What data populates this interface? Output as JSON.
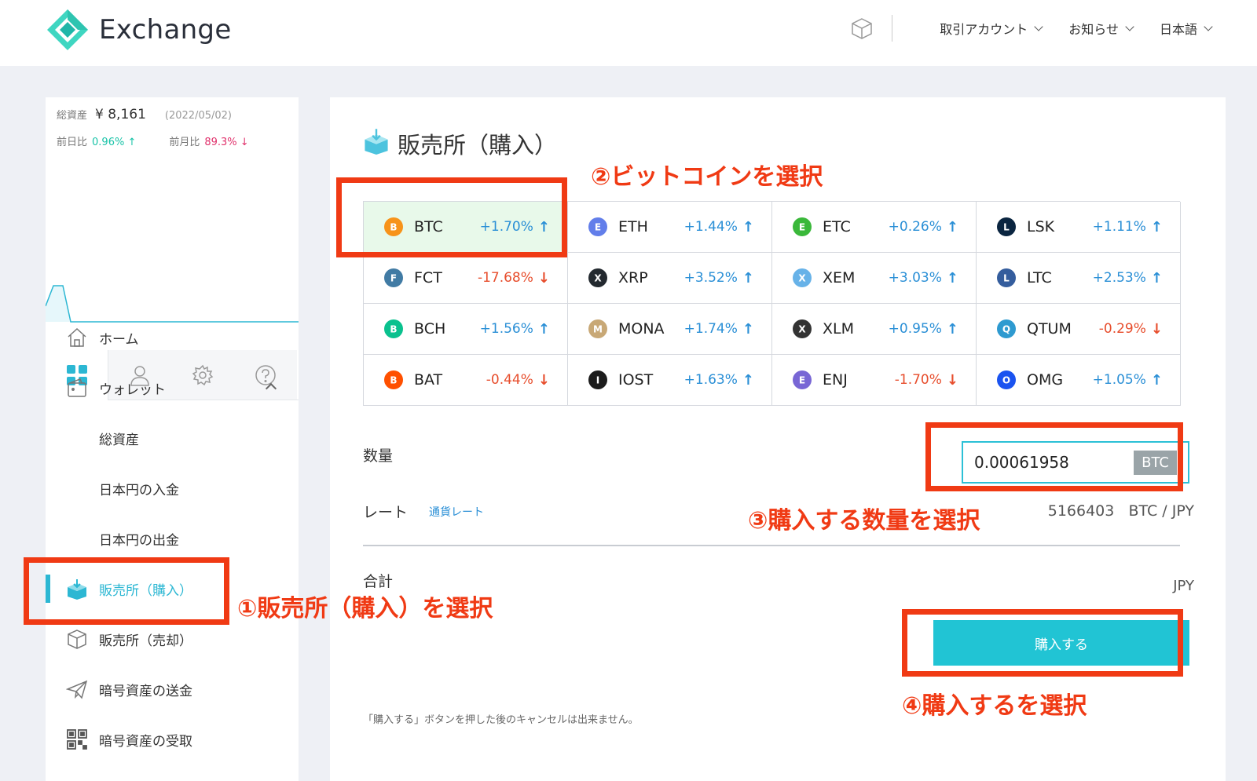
{
  "header": {
    "app_name": "Exchange",
    "menus": [
      "取引アカウント",
      "お知らせ",
      "日本語"
    ]
  },
  "sidebar": {
    "assets": {
      "label": "総資産",
      "value": "¥ 8,161",
      "date": "(2022/05/02)",
      "day_label": "前日比",
      "day_value": "0.96% ↑",
      "month_label": "前月比",
      "month_value": "89.3% ↓"
    },
    "nav": [
      {
        "label": "ホーム",
        "icon": "home-icon"
      },
      {
        "label": "ウォレット",
        "icon": "wallet-icon"
      },
      {
        "label": "総資産",
        "icon": ""
      },
      {
        "label": "日本円の入金",
        "icon": ""
      },
      {
        "label": "日本円の出金",
        "icon": ""
      },
      {
        "label": "販売所（購入）",
        "icon": "buy-box-icon",
        "active": true
      },
      {
        "label": "販売所（売却）",
        "icon": "sell-box-icon"
      },
      {
        "label": "暗号資産の送金",
        "icon": "send-icon"
      },
      {
        "label": "暗号資産の受取",
        "icon": "qr-icon"
      }
    ]
  },
  "main": {
    "title": "販売所（購入）",
    "coins": [
      {
        "symbol": "BTC",
        "change": "+1.70%",
        "dir": "up",
        "color": "#f7931a",
        "selected": true
      },
      {
        "symbol": "ETH",
        "change": "+1.44%",
        "dir": "up",
        "color": "#627eea"
      },
      {
        "symbol": "ETC",
        "change": "+0.26%",
        "dir": "up",
        "color": "#3ab83a"
      },
      {
        "symbol": "LSK",
        "change": "+1.11%",
        "dir": "up",
        "color": "#0a2540"
      },
      {
        "symbol": "FCT",
        "change": "-17.68%",
        "dir": "down",
        "color": "#417ba4"
      },
      {
        "symbol": "XRP",
        "change": "+3.52%",
        "dir": "up",
        "color": "#23292f"
      },
      {
        "symbol": "XEM",
        "change": "+3.03%",
        "dir": "up",
        "color": "#67b2e8"
      },
      {
        "symbol": "LTC",
        "change": "+2.53%",
        "dir": "up",
        "color": "#345d9d"
      },
      {
        "symbol": "BCH",
        "change": "+1.56%",
        "dir": "up",
        "color": "#0ac18e"
      },
      {
        "symbol": "MONA",
        "change": "+1.74%",
        "dir": "up",
        "color": "#c8a876"
      },
      {
        "symbol": "XLM",
        "change": "+0.95%",
        "dir": "up",
        "color": "#333333"
      },
      {
        "symbol": "QTUM",
        "change": "-0.29%",
        "dir": "down",
        "color": "#2e9ad0"
      },
      {
        "symbol": "BAT",
        "change": "-0.44%",
        "dir": "down",
        "color": "#ff5000"
      },
      {
        "symbol": "IOST",
        "change": "+1.63%",
        "dir": "up",
        "color": "#1c1c1c"
      },
      {
        "symbol": "ENJ",
        "change": "-1.70%",
        "dir": "down",
        "color": "#7866d5"
      },
      {
        "symbol": "OMG",
        "change": "+1.05%",
        "dir": "up",
        "color": "#1a53f0"
      }
    ],
    "quantity_label": "数量",
    "quantity_value": "0.00061958",
    "quantity_unit": "BTC",
    "rate_label": "レート",
    "rate_link": "通貨レート",
    "rate_value": "5166403   BTC / JPY",
    "total_label": "合計",
    "total_unit": "JPY",
    "buy_button": "購入する",
    "notice": "「購入する」ボタンを押した後のキャンセルは出来ません。"
  },
  "annotations": {
    "step1": "①販売所（購入）を選択",
    "step2": "②ビットコインを選択",
    "step3": "③購入する数量を選択",
    "step4": "④購入するを選択"
  },
  "colors": {
    "accent": "#2cb7d3",
    "button": "#21c4d4",
    "annotation": "#f03a14",
    "up": "#2a8fd6",
    "down": "#e74d2c"
  }
}
